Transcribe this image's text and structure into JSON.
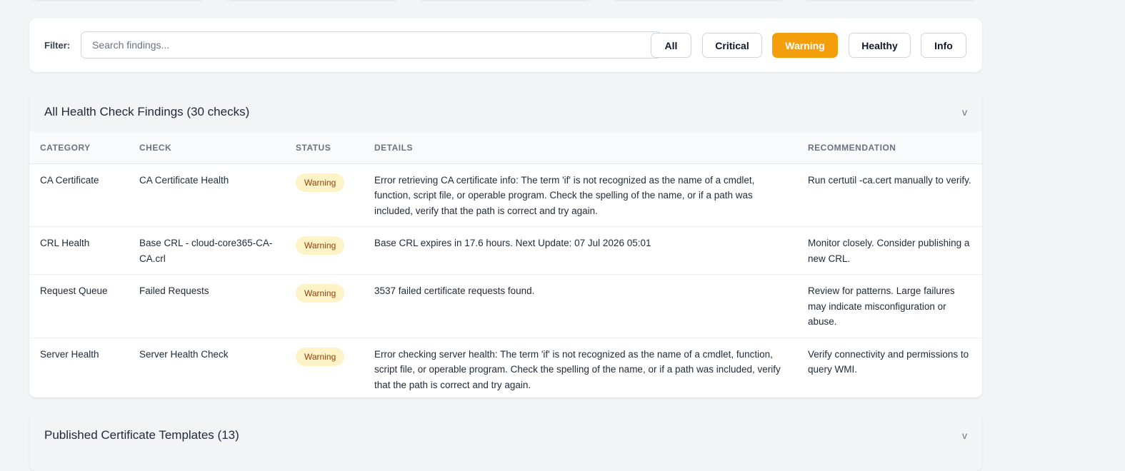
{
  "filter": {
    "label": "Filter:",
    "search_placeholder": "Search findings...",
    "buttons": [
      {
        "label": "All",
        "active": false
      },
      {
        "label": "Critical",
        "active": false
      },
      {
        "label": "Warning",
        "active": true
      },
      {
        "label": "Healthy",
        "active": false
      },
      {
        "label": "Info",
        "active": false
      }
    ]
  },
  "findings": {
    "title": "All Health Check Findings (30 checks)",
    "chevron": "v",
    "columns": [
      "CATEGORY",
      "CHECK",
      "STATUS",
      "DETAILS",
      "RECOMMENDATION"
    ],
    "rows": [
      {
        "category": "CA Certificate",
        "check": "CA Certificate Health",
        "status": "Warning",
        "details": "Error retrieving CA certificate info: The term 'if' is not recognized as the name of a cmdlet, function, script file, or operable program. Check the spelling of the name, or if a path was included, verify that the path is correct and try again.",
        "recommendation": "Run certutil -ca.cert manually to verify."
      },
      {
        "category": "CRL Health",
        "check": "Base CRL - cloud-core365-CA-CA.crl",
        "status": "Warning",
        "details": "Base CRL expires in 17.6 hours. Next Update: 07 Jul 2026 05:01",
        "recommendation": "Monitor closely. Consider publishing a new CRL."
      },
      {
        "category": "Request Queue",
        "check": "Failed Requests",
        "status": "Warning",
        "details": "3537 failed certificate requests found.",
        "recommendation": "Review for patterns. Large failures may indicate misconfiguration or abuse."
      },
      {
        "category": "Server Health",
        "check": "Server Health Check",
        "status": "Warning",
        "details": "Error checking server health: The term 'if' is not recognized as the name of a cmdlet, function, script file, or operable program. Check the spelling of the name, or if a path was included, verify that the path is correct and try again.",
        "recommendation": "Verify connectivity and permissions to query WMI."
      }
    ]
  },
  "templates": {
    "title": "Published Certificate Templates (13)",
    "chevron": "v"
  },
  "colors": {
    "accent_warning": "#f59e0b",
    "badge_bg": "#fef3c7",
    "badge_text": "#92400e",
    "page_bg": "#f3f4f6"
  }
}
